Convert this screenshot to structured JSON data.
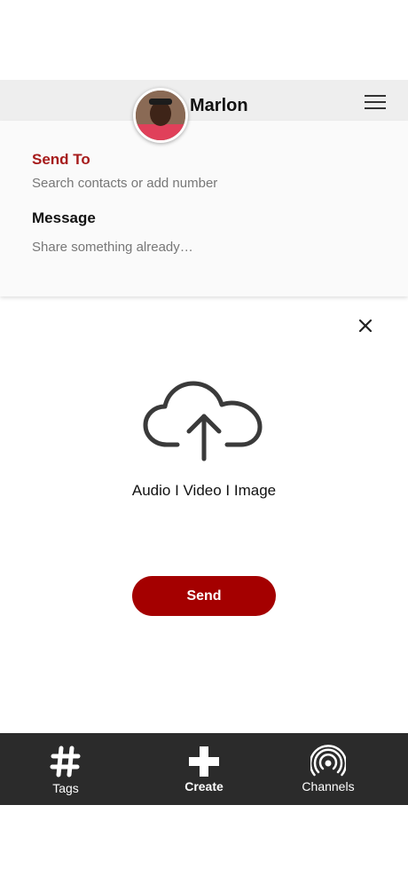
{
  "header": {
    "user_name": "Marlon",
    "avatar_icon": "user-avatar-photo",
    "menu_icon": "hamburger-menu-icon"
  },
  "compose": {
    "send_to_label": "Send To",
    "send_to_placeholder": "Search contacts or add number",
    "send_to_value": "",
    "message_label": "Message",
    "message_placeholder": "Share something already…",
    "message_value": ""
  },
  "upload": {
    "icon": "cloud-upload-icon",
    "media_types": "Audio I Video I Image",
    "close_icon": "close-icon"
  },
  "actions": {
    "send_label": "Send"
  },
  "bottom_nav": {
    "items": [
      {
        "label": "Tags",
        "icon": "hashtag-icon"
      },
      {
        "label": "Create",
        "icon": "plus-icon"
      },
      {
        "label": "Channels",
        "icon": "broadcast-icon"
      }
    ]
  },
  "colors": {
    "accent": "#a40000",
    "send_to_label": "#a61b1b",
    "nav_background": "#2b2b2b",
    "header_background": "#eeeeee"
  }
}
